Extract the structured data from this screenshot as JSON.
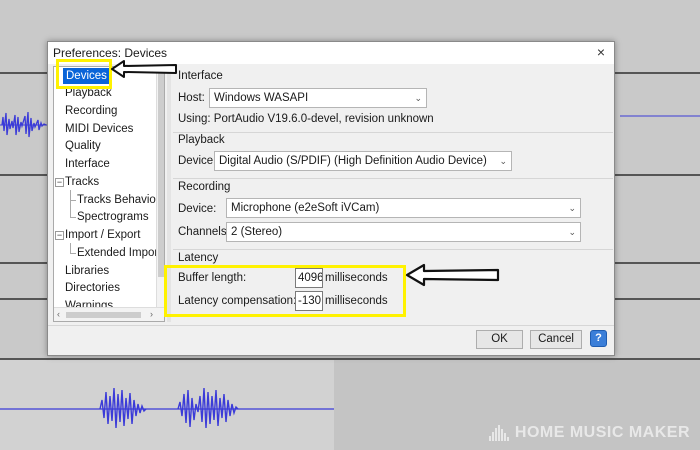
{
  "dialog": {
    "title": "Preferences: Devices",
    "close_glyph": "×"
  },
  "tree": {
    "items": [
      {
        "label": "Devices",
        "selected": true
      },
      {
        "label": "Playback"
      },
      {
        "label": "Recording"
      },
      {
        "label": "MIDI Devices"
      },
      {
        "label": "Quality"
      },
      {
        "label": "Interface"
      },
      {
        "label": "Tracks",
        "expander": "−"
      },
      {
        "label": "Tracks Behavior"
      },
      {
        "label": "Spectrograms"
      },
      {
        "label": "Import / Export",
        "expander": "−"
      },
      {
        "label": "Extended Import"
      },
      {
        "label": "Libraries"
      },
      {
        "label": "Directories"
      },
      {
        "label": "Warnings"
      }
    ],
    "scroll_left": "‹",
    "scroll_right": "›"
  },
  "interface": {
    "heading": "Interface",
    "host_label": "Host:",
    "host_value": "Windows WASAPI",
    "using_text": "Using: PortAudio V19.6.0-devel, revision unknown"
  },
  "playback": {
    "heading": "Playback",
    "device_label": "Device:",
    "device_value": "Digital Audio (S/PDIF) (High Definition Audio Device)"
  },
  "recording": {
    "heading": "Recording",
    "device_label": "Device:",
    "device_value": "Microphone (e2eSoft iVCam)",
    "channels_label": "Channels:",
    "channels_value": "2 (Stereo)"
  },
  "latency": {
    "heading": "Latency",
    "buffer_label": "Buffer length:",
    "buffer_value": "4096",
    "buffer_unit": "milliseconds",
    "compensation_label": "Latency compensation:",
    "compensation_value": "-130",
    "compensation_unit": "milliseconds"
  },
  "buttons": {
    "ok": "OK",
    "cancel": "Cancel",
    "help": "?"
  },
  "watermark": "HOME MUSIC MAKER",
  "colors": {
    "highlight": "#fff200",
    "selection": "#0a64d8",
    "waveform": "#3b3bd8"
  }
}
